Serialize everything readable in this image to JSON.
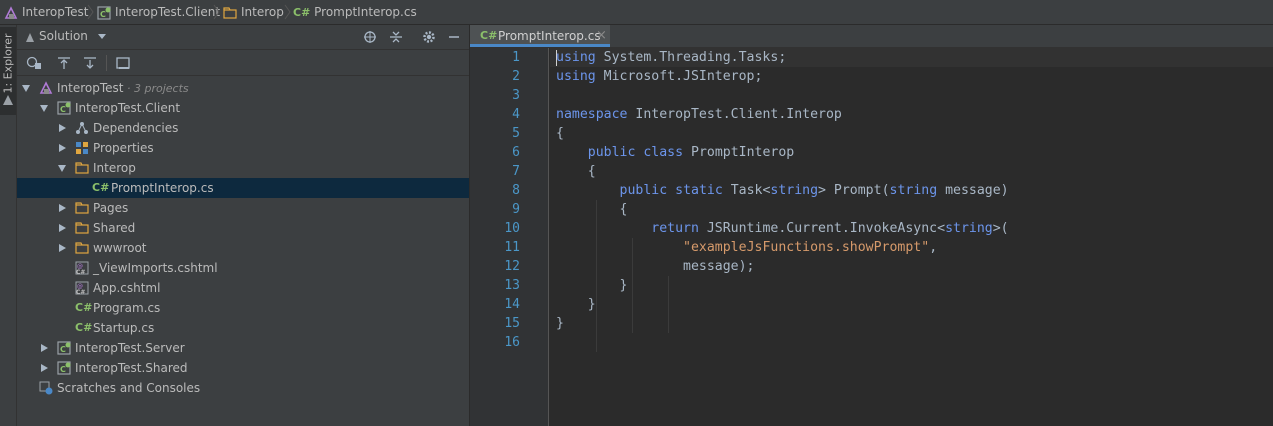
{
  "breadcrumb": [
    {
      "label": "InteropTest",
      "icon": "solution-icon"
    },
    {
      "label": "InteropTest.Client",
      "icon": "csharp-project-icon"
    },
    {
      "label": "Interop",
      "icon": "folder-icon"
    },
    {
      "label": "PromptInterop.cs",
      "icon": "csharp-file-icon"
    }
  ],
  "toolstrip": {
    "explorer_label": "1: Explorer"
  },
  "sidebar": {
    "title": "Solution",
    "tree": [
      {
        "label": "InteropTest",
        "note": "· 3 projects",
        "depth": 0,
        "expanded": true,
        "icon": "solution-icon"
      },
      {
        "label": "InteropTest.Client",
        "depth": 1,
        "expanded": true,
        "icon": "csharp-project-icon"
      },
      {
        "label": "Dependencies",
        "depth": 2,
        "expanded": false,
        "icon": "dependencies-icon"
      },
      {
        "label": "Properties",
        "depth": 2,
        "expanded": false,
        "icon": "properties-icon"
      },
      {
        "label": "Interop",
        "depth": 2,
        "expanded": true,
        "icon": "folder-icon"
      },
      {
        "label": "PromptInterop.cs",
        "depth": 3,
        "selected": true,
        "icon": "csharp-file-icon"
      },
      {
        "label": "Pages",
        "depth": 2,
        "expanded": false,
        "icon": "folder-icon"
      },
      {
        "label": "Shared",
        "depth": 2,
        "expanded": false,
        "icon": "folder-icon"
      },
      {
        "label": "wwwroot",
        "depth": 2,
        "expanded": false,
        "icon": "folder-icon"
      },
      {
        "label": "_ViewImports.cshtml",
        "depth": 2,
        "icon": "cshtml-file-icon"
      },
      {
        "label": "App.cshtml",
        "depth": 2,
        "icon": "cshtml-file-icon"
      },
      {
        "label": "Program.cs",
        "depth": 2,
        "icon": "csharp-file-icon"
      },
      {
        "label": "Startup.cs",
        "depth": 2,
        "icon": "csharp-file-icon"
      },
      {
        "label": "InteropTest.Server",
        "depth": 1,
        "expanded": false,
        "icon": "csharp-project-icon"
      },
      {
        "label": "InteropTest.Shared",
        "depth": 1,
        "expanded": false,
        "icon": "csharp-project-icon"
      },
      {
        "label": "Scratches and Consoles",
        "depth": 0,
        "icon": "scratches-icon"
      }
    ]
  },
  "editor": {
    "tab": {
      "label": "PromptInterop.cs",
      "icon_text": "C#",
      "close": "×"
    },
    "line_numbers": [
      "1",
      "2",
      "3",
      "4",
      "5",
      "6",
      "7",
      "8",
      "9",
      "10",
      "11",
      "12",
      "13",
      "14",
      "15",
      "16"
    ],
    "lines": [
      [
        {
          "t": "using",
          "c": "kw"
        },
        {
          "t": " System.Threading.Tasks;"
        }
      ],
      [
        {
          "t": "using",
          "c": "kw"
        },
        {
          "t": " Microsoft.JSInterop;"
        }
      ],
      [],
      [
        {
          "t": "namespace",
          "c": "kw"
        },
        {
          "t": " InteropTest.Client.Interop"
        }
      ],
      [
        {
          "t": "{"
        }
      ],
      [
        {
          "t": "    "
        },
        {
          "t": "public",
          "c": "kw"
        },
        {
          "t": " "
        },
        {
          "t": "class",
          "c": "kw"
        },
        {
          "t": " PromptInterop"
        }
      ],
      [
        {
          "t": "    {"
        }
      ],
      [
        {
          "t": "        "
        },
        {
          "t": "public",
          "c": "kw"
        },
        {
          "t": " "
        },
        {
          "t": "static",
          "c": "kw"
        },
        {
          "t": " Task<"
        },
        {
          "t": "string",
          "c": "kw"
        },
        {
          "t": "> Prompt("
        },
        {
          "t": "string",
          "c": "kw"
        },
        {
          "t": " message)"
        }
      ],
      [
        {
          "t": "        {"
        }
      ],
      [
        {
          "t": "            "
        },
        {
          "t": "return",
          "c": "kw"
        },
        {
          "t": " JSRuntime.Current.InvokeAsync<"
        },
        {
          "t": "string",
          "c": "kw"
        },
        {
          "t": ">("
        }
      ],
      [
        {
          "t": "                "
        },
        {
          "t": "\"exampleJsFunctions.showPrompt\"",
          "c": "str"
        },
        {
          "t": ","
        }
      ],
      [
        {
          "t": "                message);"
        }
      ],
      [
        {
          "t": "        }"
        }
      ],
      [
        {
          "t": "    }"
        }
      ],
      [
        {
          "t": "}"
        }
      ],
      []
    ]
  }
}
